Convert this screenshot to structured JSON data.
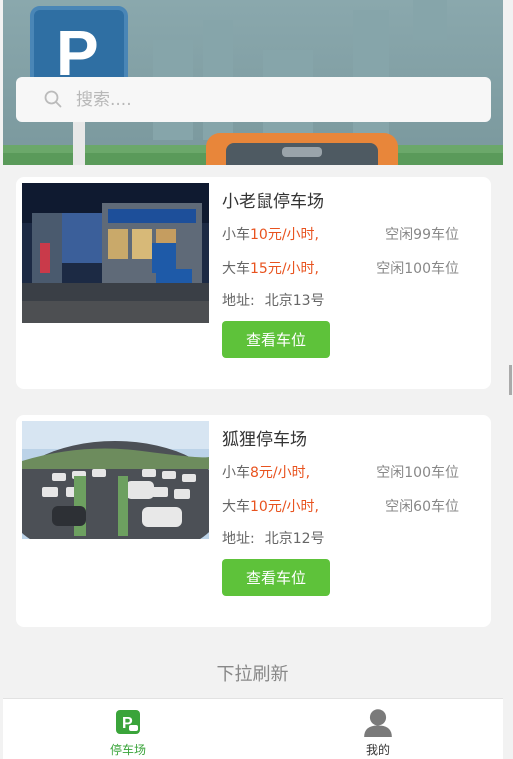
{
  "search": {
    "placeholder": "搜索...."
  },
  "lots": [
    {
      "name": "小老鼠停车场",
      "small_label": "小车",
      "small_price": "10元/小时,",
      "small_free": "空闲99车位",
      "large_label": "大车",
      "large_price": "15元/小时,",
      "large_free": "空闲100车位",
      "addr_label": "地址:",
      "addr": "北京13号",
      "button": "查看车位"
    },
    {
      "name": "狐狸停车场",
      "small_label": "小车",
      "small_price": "8元/小时,",
      "small_free": "空闲100车位",
      "large_label": "大车",
      "large_price": "10元/小时,",
      "large_free": "空闲60车位",
      "addr_label": "地址:",
      "addr": "北京12号",
      "button": "查看车位"
    }
  ],
  "refresh_text": "下拉刷新",
  "tabs": [
    {
      "label": "停车场",
      "icon": "parking-icon",
      "active": true
    },
    {
      "label": "我的",
      "icon": "user-icon",
      "active": false
    }
  ],
  "colors": {
    "accent": "#5ec23a",
    "price": "#e8531f",
    "tab_active": "#3aa43a"
  }
}
